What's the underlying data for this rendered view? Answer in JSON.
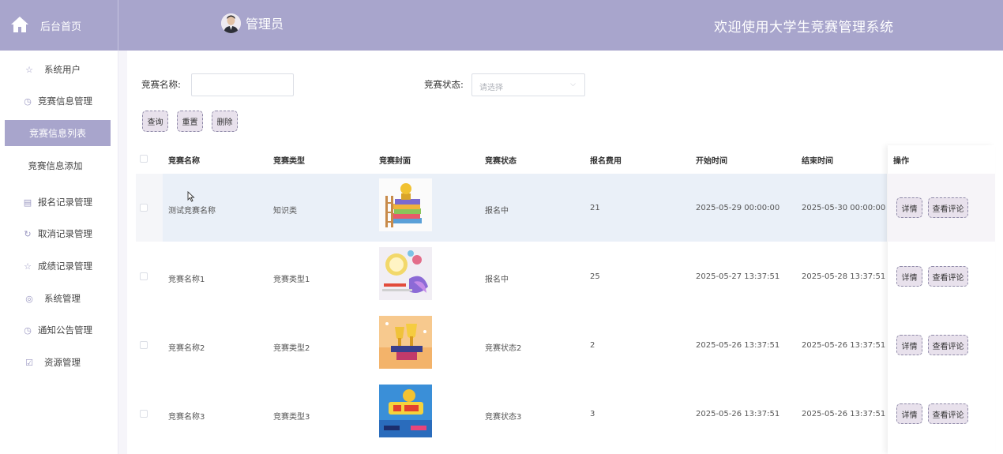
{
  "header": {
    "home_label": "后台首页",
    "admin_label": "管理员",
    "welcome": "欢迎使用大学生竞赛管理系统",
    "bar_color": "#a8a5cc"
  },
  "sidebar": {
    "items": [
      {
        "label": "系统用户",
        "icon": "star-icon"
      },
      {
        "label": "竞赛信息管理",
        "icon": "clock-icon"
      },
      {
        "label": "竞赛信息列表",
        "icon": "",
        "active": true
      },
      {
        "label": "竞赛信息添加",
        "icon": ""
      },
      {
        "label": "报名记录管理",
        "icon": "calendar-icon"
      },
      {
        "label": "取消记录管理",
        "icon": "refresh-icon"
      },
      {
        "label": "成绩记录管理",
        "icon": "star-icon"
      },
      {
        "label": "系统管理",
        "icon": "compass-icon"
      },
      {
        "label": "通知公告管理",
        "icon": "clock-icon"
      },
      {
        "label": "资源管理",
        "icon": "calendar-check-icon"
      }
    ]
  },
  "search": {
    "name_label": "竞赛名称:",
    "name_value": "",
    "status_label": "竞赛状态:",
    "status_placeholder": "请选择",
    "query_button": "查询",
    "reset_button": "重置",
    "delete_button": "删除"
  },
  "table": {
    "headers": [
      "竞赛名称",
      "竞赛类型",
      "竞赛封面",
      "竞赛状态",
      "报名费用",
      "开始时间",
      "结束时间",
      "操作"
    ],
    "rows": [
      {
        "name": "测试竞赛名称",
        "type": "知识类",
        "cover": "trophy-books",
        "status": "报名中",
        "fee": "21",
        "start": "2025-05-29 00:00:00",
        "end": "2025-05-30 00:00:00"
      },
      {
        "name": "竞赛名称1",
        "type": "竞赛类型1",
        "cover": "lightbulb-art",
        "status": "报名中",
        "fee": "25",
        "start": "2025-05-27 13:37:51",
        "end": "2025-05-28 13:37:51"
      },
      {
        "name": "竞赛名称2",
        "type": "竞赛类型2",
        "cover": "trophies",
        "status": "竞赛状态2",
        "fee": "2",
        "start": "2025-05-26 13:37:51",
        "end": "2025-05-26 13:37:51"
      },
      {
        "name": "竞赛名称3",
        "type": "竞赛类型3",
        "cover": "gold-medal-poster",
        "status": "竞赛状态3",
        "fee": "3",
        "start": "2025-05-26 13:37:51",
        "end": "2025-05-26 13:37:51"
      }
    ],
    "detail_button": "详情",
    "comment_button": "查看评论"
  }
}
